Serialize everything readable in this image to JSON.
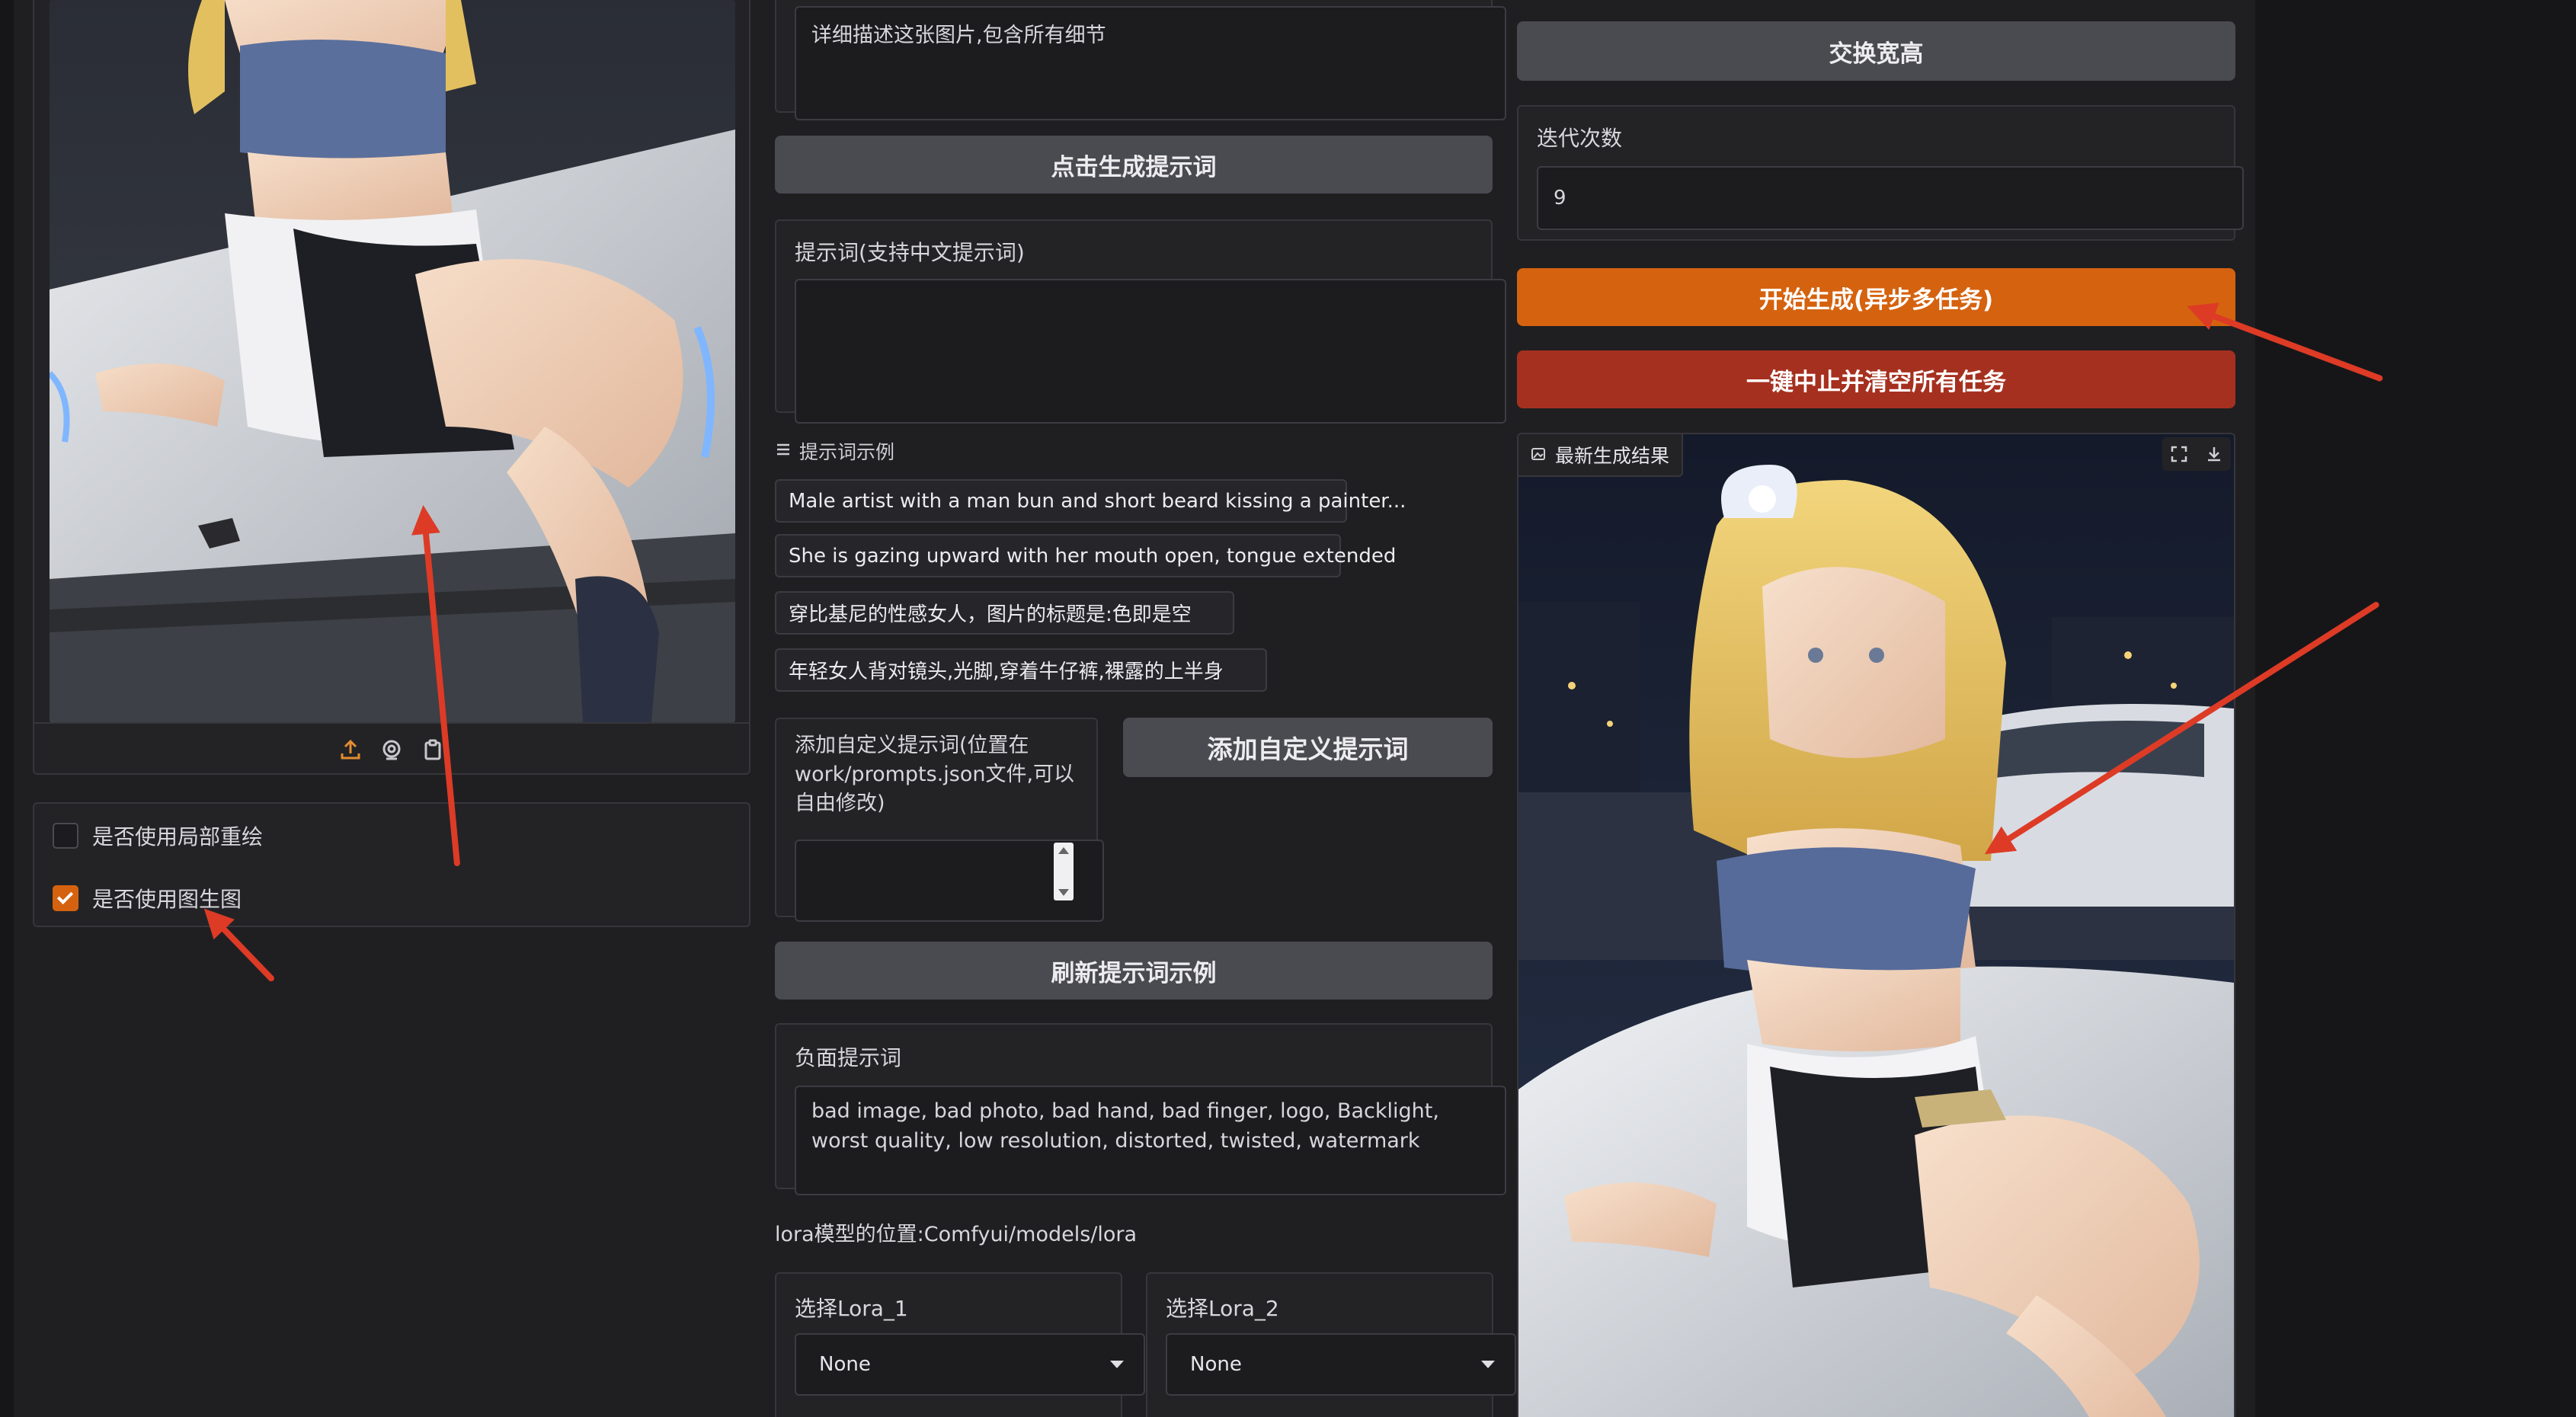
{
  "left_column": {
    "inpaint_checkbox": {
      "label": "是否使用局部重绘",
      "checked": false
    },
    "img2img_checkbox": {
      "label": "是否使用图生图",
      "checked": true
    },
    "upload_icons": [
      "upload-icon",
      "webcam-icon",
      "clipboard-icon"
    ]
  },
  "middle_column": {
    "caption_input_value": "详细描述这张图片,包含所有细节",
    "generate_prompt_button": "点击生成提示词",
    "prompt_label": "提示词(支持中文提示词)",
    "prompt_value": "",
    "examples_label": "提示词示例",
    "examples": [
      "Male artist with a man bun and short beard kissing a painter...",
      "She is gazing upward with her mouth open, tongue extended",
      "穿比基尼的性感女人，图片的标题是:色即是空",
      "年轻女人背对镜头,光脚,穿着牛仔裤,裸露的上半身"
    ],
    "custom_prompt_label": "添加自定义提示词(位置在work/prompts.json文件,可以自由修改)",
    "custom_prompt_value": "",
    "add_custom_button": "添加自定义提示词",
    "refresh_examples_button": "刷新提示词示例",
    "negative_label": "负面提示词",
    "negative_value": "bad image, bad photo, bad hand, bad finger, logo, Backlight, worst quality, low resolution, distorted, twisted, watermark",
    "lora_path_text": "lora模型的位置:Comfyui/models/lora",
    "lora1_label": "选择Lora_1",
    "lora1_value": "None",
    "lora2_label": "选择Lora_2",
    "lora2_value": "None"
  },
  "right_column": {
    "swap_button": "交换宽高",
    "iterations_label": "迭代次数",
    "iterations_value": "9",
    "start_button": "开始生成(异步多任务)",
    "stop_button": "一键中止并清空所有任务",
    "result_label": "最新生成结果",
    "result_icons": [
      "fullscreen-icon",
      "download-icon"
    ]
  },
  "colors": {
    "background": "#1f1f22",
    "panel": "#232326",
    "button": "#4a4a51",
    "accent_orange": "#d5620f",
    "danger_red": "#a6301f",
    "annotation_arrow": "#dd3b26"
  }
}
